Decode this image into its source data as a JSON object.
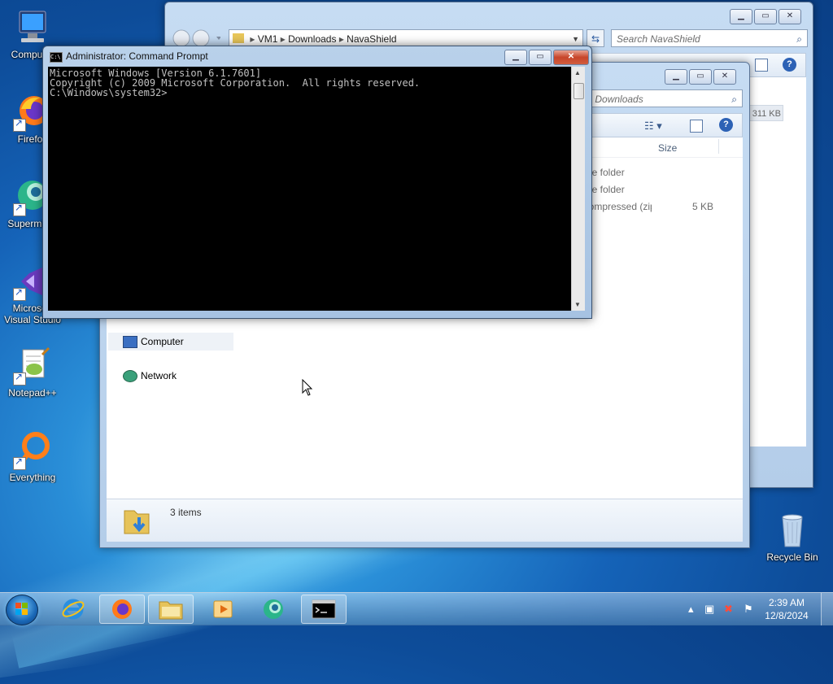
{
  "desktop_icons": [
    {
      "name": "computer",
      "label": "Computer"
    },
    {
      "name": "firefox",
      "label": "Firefox"
    },
    {
      "name": "supermium",
      "label": "Supermium"
    },
    {
      "name": "visual-studio",
      "label": "Microsoft Visual Studio"
    },
    {
      "name": "notepadpp",
      "label": "Notepad++"
    },
    {
      "name": "everything",
      "label": "Everything"
    },
    {
      "name": "recycle-bin",
      "label": "Recycle Bin"
    }
  ],
  "explorer_main": {
    "breadcrumb": [
      "VM1",
      "Downloads",
      "NavaShield"
    ],
    "search_placeholder": "Search NavaShield",
    "nav_items": [
      {
        "label": "Computer"
      },
      {
        "label": "Network"
      }
    ],
    "status": "3 items"
  },
  "explorer_second": {
    "search_placeholder": "Search Downloads",
    "partial_size": "311 KB",
    "column_size": "Size",
    "rows": [
      {
        "type": "File folder",
        "size": ""
      },
      {
        "type": "File folder",
        "size": ""
      },
      {
        "type": "Compressed (zipped) Folder",
        "size": "5 KB"
      }
    ]
  },
  "cmd": {
    "title": "Administrator: Command Prompt",
    "lines": [
      "Microsoft Windows [Version 6.1.7601]",
      "Copyright (c) 2009 Microsoft Corporation.  All rights reserved.",
      "",
      "C:\\Windows\\system32>"
    ]
  },
  "taskbar": {
    "time": "2:39 AM",
    "date": "12/8/2024"
  }
}
